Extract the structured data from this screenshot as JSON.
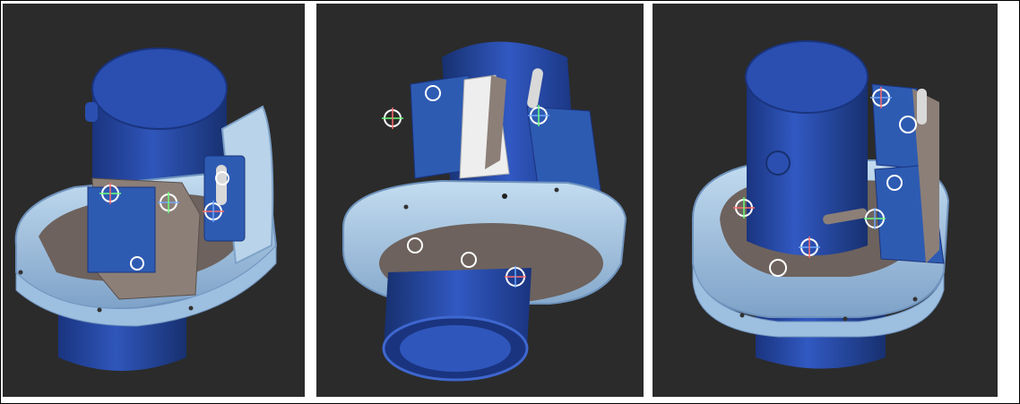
{
  "colors": {
    "frame_border": "#000000",
    "viewport_background": "#2b2b2b",
    "cylinder_blue": "#1e3f9a",
    "cylinder_highlight": "#3e67cf",
    "ring_light_blue": "#a9c9e6",
    "ring_shadow": "#6f93bd",
    "bracket_gray": "#8c7f78",
    "servo_blue": "#2e5bb2",
    "mate_connector_white": "#ffffff",
    "axis_red": "#ff6a6a",
    "axis_green": "#6cff7a",
    "axis_blue": "#6fa8ff"
  },
  "views": [
    {
      "label": "",
      "icons": [
        "mate-connector-icon",
        "servo-icon",
        "servo-horn-icon"
      ]
    },
    {
      "label": "",
      "icons": [
        "mate-connector-icon",
        "servo-icon",
        "servo-horn-icon"
      ]
    },
    {
      "label": "",
      "icons": [
        "mate-connector-icon",
        "servo-icon",
        "servo-horn-icon"
      ]
    }
  ]
}
